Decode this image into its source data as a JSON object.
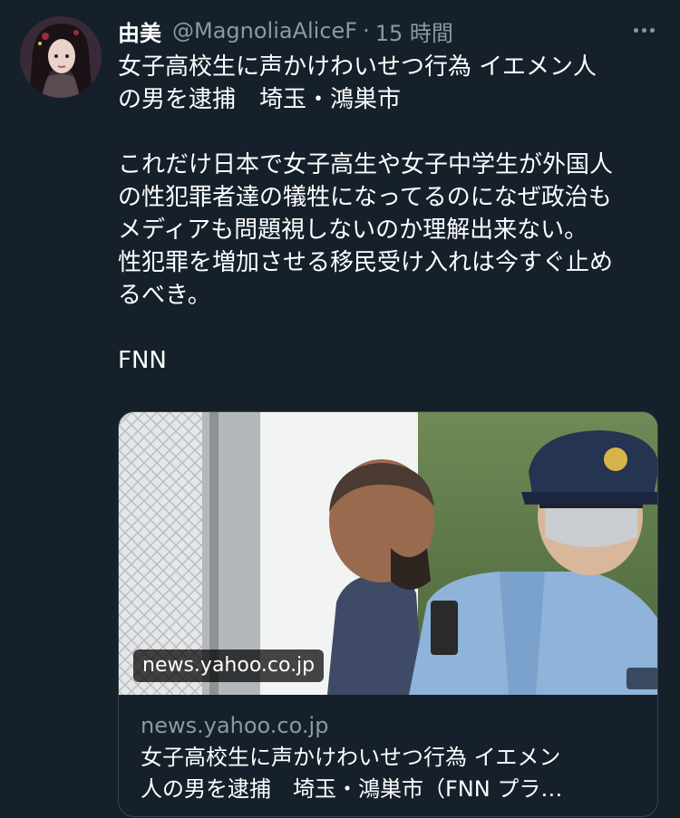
{
  "tweet": {
    "display_name": "由美",
    "handle": "@MagnoliaAliceF",
    "separator": "·",
    "time": "15 時間",
    "text": "女子高校生に声かけわいせつ行為 イエメン人\nの男を逮捕　埼玉・鴻巣市\n\nこれだけ日本で女子高生や女子中学生が外国人\nの性犯罪者達の犠牲になってるのになぜ政治も\nメディアも問題視しないのか理解出来ない。\n性犯罪を増加させる移民受け入れは今すぐ止め\nるべき。\n\nFNN"
  },
  "card": {
    "image_badge": "news.yahoo.co.jp",
    "domain": "news.yahoo.co.jp",
    "title": "女子高校生に声かけわいせつ行為 イエメン\n人の男を逮捕　埼玉・鴻巣市（FNN プラ…"
  },
  "colors": {
    "background": "#15202b",
    "secondary_text": "#8b98a5",
    "border": "#38444d"
  },
  "icons": {
    "more": "more-horizontal-icon"
  }
}
